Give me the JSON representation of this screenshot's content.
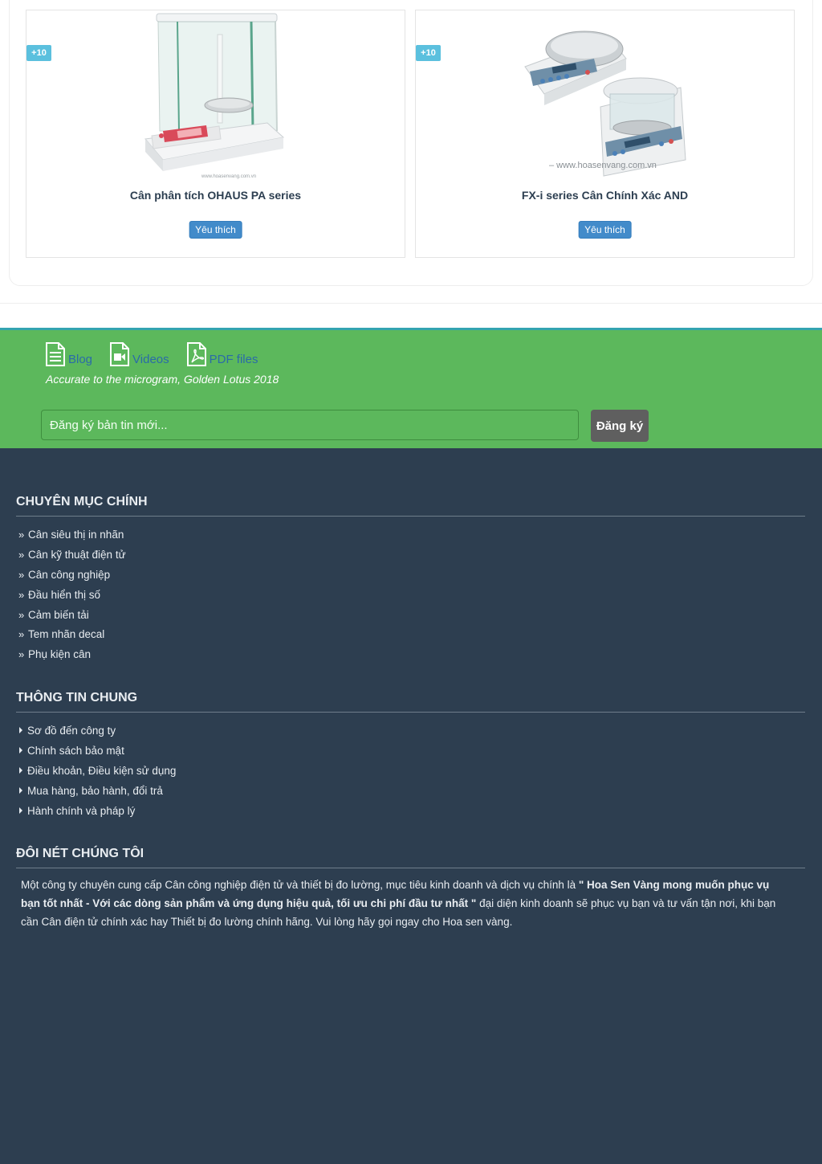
{
  "products": [
    {
      "badge": "+10",
      "name": "Cân phân tích OHAUS PA series",
      "fav_label": "Yêu thích",
      "watermark": "www.hoasenvang.com.vn"
    },
    {
      "badge": "+10",
      "name": "FX-i series Cân Chính Xác AND",
      "fav_label": "Yêu thích",
      "watermark": "– www.hoasenvang.com.vn"
    }
  ],
  "quick_links": [
    {
      "label": "Blog",
      "icon": "document-icon"
    },
    {
      "label": "Videos",
      "icon": "video-file-icon"
    },
    {
      "label": "PDF files",
      "icon": "pdf-file-icon"
    }
  ],
  "tagline": "Accurate to the microgram, Golden Lotus 2018",
  "newsletter": {
    "placeholder": "Đăng ký bản tin mới...",
    "button": "Đăng ký"
  },
  "footer": {
    "main_categories": {
      "title": "CHUYÊN MỤC CHÍNH",
      "items": [
        "Cân siêu thị in nhãn",
        "Cân kỹ thuật điện tử",
        "Cân công nghiệp",
        "Đầu hiển thị số",
        "Cảm biến tải",
        "Tem nhãn decal",
        "Phụ kiện cân"
      ]
    },
    "general_info": {
      "title": "THÔNG TIN CHUNG",
      "items": [
        "Sơ đồ đến công ty",
        "Chính sách bảo mật",
        "Điều khoản, Điều kiện sử dụng",
        "Mua hàng, bảo hành, đổi trả",
        "Hành chính và pháp lý"
      ]
    },
    "about": {
      "title": "ĐÔI NÉT CHÚNG TÔI",
      "text_before": "Một công ty chuyên cung cấp Cân công nghiệp điện tử và thiết bị đo lường, mục tiêu kinh doanh và dịch vụ chính là ",
      "text_bold": "\" Hoa Sen Vàng mong muốn phục vụ bạn tốt nhất - Với các dòng sản phẩm và ứng dụng hiệu quả, tối ưu chi phí đầu tư nhất \"",
      "text_after": " đại diện kinh doanh sẽ phục vụ bạn và tư vấn tận nơi, khi bạn cần Cân điện tử chính xác hay Thiết bị đo lường chính hãng. Vui lòng hãy gọi ngay cho Hoa sen vàng."
    }
  },
  "colors": {
    "green": "#5cb85c",
    "footer_bg": "#2d3e50",
    "badge": "#5bc0de",
    "button_blue": "#428bca",
    "link_blue": "#2a6ba8"
  }
}
